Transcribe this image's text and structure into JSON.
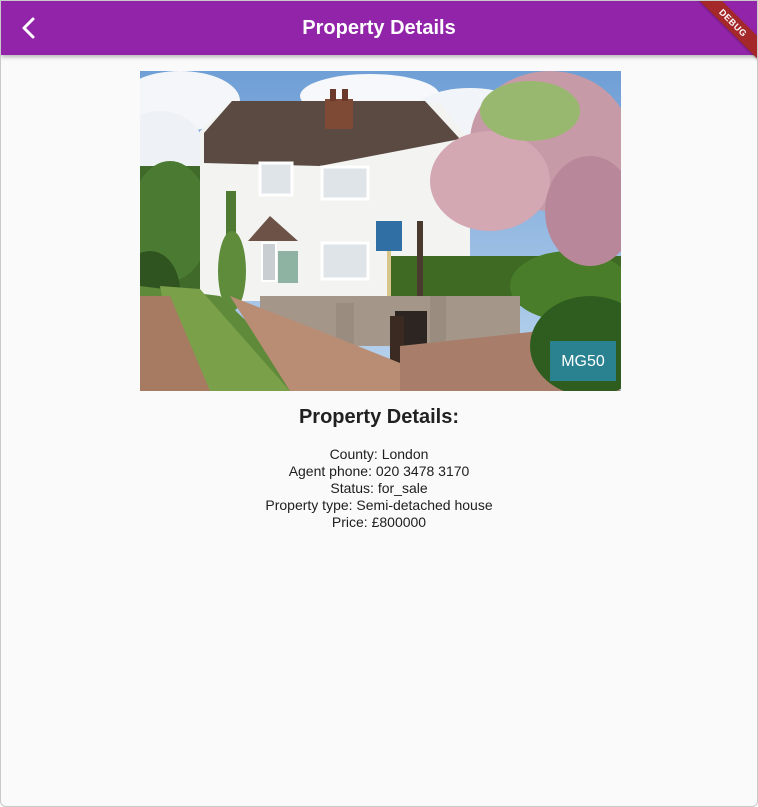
{
  "appbar": {
    "title": "Property Details",
    "back_icon": "chevron-left-icon",
    "background_color": "#9124a9",
    "debug_banner": "DEBUG"
  },
  "photo": {
    "description_icon": "house-photo",
    "watermark_text": "MG50"
  },
  "details": {
    "heading": "Property Details:",
    "county": "County: London",
    "agent_phone": "Agent phone: 020 3478 3170",
    "status": "Status: for_sale",
    "property_type": "Property type: Semi-detached house",
    "price": "Price: £800000"
  }
}
